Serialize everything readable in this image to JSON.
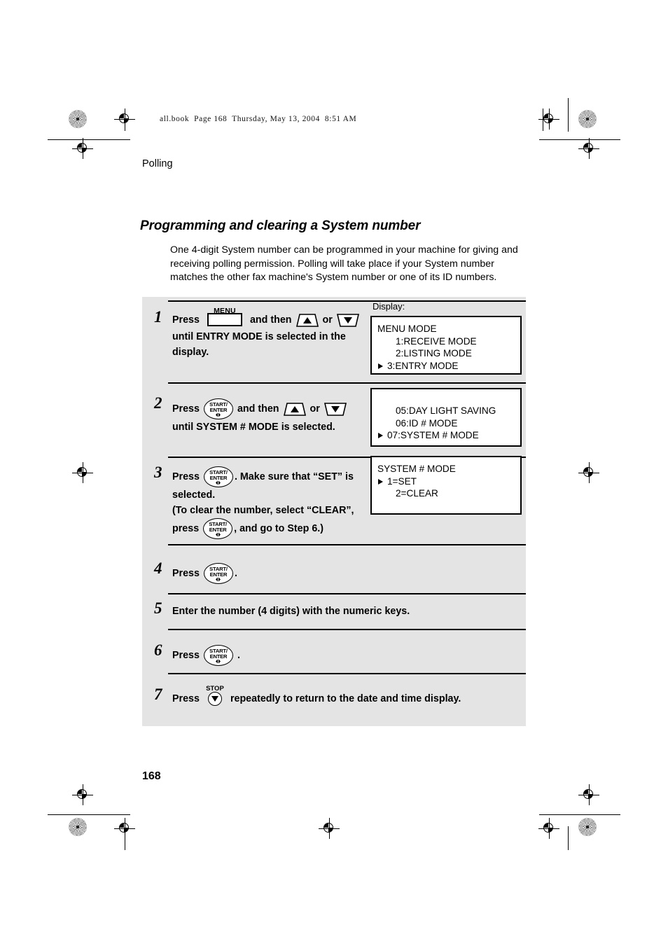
{
  "print_header": "all.book  Page 168  Thursday, May 13, 2004  8:51 AM",
  "running_head": "Polling",
  "section_title": "Programming and clearing a System number",
  "intro_paragraph": "One 4-digit System number can be programmed in your machine for giving and receiving polling permission. Polling will take place if your System number matches the other fax machine's System number or one of its ID numbers.",
  "display_label": "Display:",
  "page_number": "168",
  "keys": {
    "menu": "MENU",
    "enter_line1": "START/",
    "enter_line2": "ENTER",
    "stop": "STOP"
  },
  "steps": [
    {
      "number": "1",
      "text_a": "Press",
      "text_b": "and then",
      "text_c": "or",
      "text_d": "until ENTRY MODE is selected in the display."
    },
    {
      "number": "2",
      "text_a": "Press",
      "text_b": "and then",
      "text_c": "or",
      "text_d": "until SYSTEM # MODE is selected."
    },
    {
      "number": "3",
      "text_a": "Press",
      "text_b": ". Make sure that “SET” is",
      "text_c": "selected.",
      "text_d": "(To clear the number, select “CLEAR”,",
      "text_e": "press",
      "text_f": ", and go to Step 6.)"
    },
    {
      "number": "4",
      "text_a": "Press",
      "text_b": "."
    },
    {
      "number": "5",
      "text_a": "Enter the number (4 digits) with the numeric keys."
    },
    {
      "number": "6",
      "text_a": "Press",
      "text_b": "."
    },
    {
      "number": "7",
      "text_a": "Press",
      "text_b": "repeatedly to return to the date and time display."
    }
  ],
  "displays": [
    {
      "id": "step1",
      "lines": [
        {
          "text": "MENU MODE",
          "indent": "flush",
          "caret": false
        },
        {
          "text": "1:RECEIVE MODE",
          "indent": "deep",
          "caret": false
        },
        {
          "text": "2:LISTING MODE",
          "indent": "deep",
          "caret": false
        },
        {
          "text": "3:ENTRY MODE",
          "indent": "ind",
          "caret": true
        }
      ]
    },
    {
      "id": "step2",
      "lines": [
        {
          "text": "05:DAY LIGHT SAVING",
          "indent": "deep",
          "caret": false
        },
        {
          "text": "06:ID # MODE",
          "indent": "deep",
          "caret": false
        },
        {
          "text": "07:SYSTEM # MODE",
          "indent": "ind",
          "caret": true
        }
      ]
    },
    {
      "id": "step3",
      "lines": [
        {
          "text": "SYSTEM # MODE",
          "indent": "flush",
          "caret": false
        },
        {
          "text": "1=SET",
          "indent": "ind",
          "caret": true
        },
        {
          "text": "2=CLEAR",
          "indent": "deep",
          "caret": false
        }
      ]
    }
  ]
}
